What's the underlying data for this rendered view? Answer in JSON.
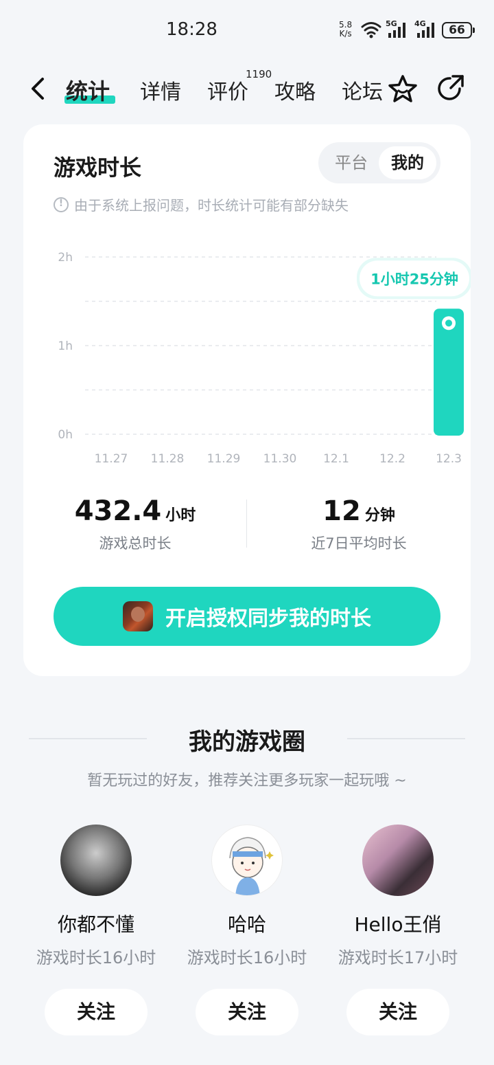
{
  "status_bar": {
    "time": "18:28",
    "net_speed_value": "5.8",
    "net_speed_unit": "K/s",
    "signal1": "5G",
    "signal2": "4G",
    "battery": "66"
  },
  "nav": {
    "tabs": [
      {
        "label": "统计",
        "active": true
      },
      {
        "label": "详情"
      },
      {
        "label": "评价",
        "badge": "1190"
      },
      {
        "label": "攻略"
      },
      {
        "label": "论坛"
      }
    ],
    "back_icon": "chevron-left-icon",
    "favorite_icon": "star-icon",
    "share_icon": "share-icon"
  },
  "card": {
    "title": "游戏时长",
    "toggle": {
      "options": [
        "平台",
        "我的"
      ],
      "selected": "我的"
    },
    "notice": "由于系统上报问题，时长统计可能有部分缺失",
    "stats": [
      {
        "value": "432.4",
        "unit": "小时",
        "label": "游戏总时长"
      },
      {
        "value": "12",
        "unit": "分钟",
        "label": "近7日平均时长"
      }
    ],
    "sync_button": "开启授权同步我的时长"
  },
  "chart_data": {
    "type": "bar",
    "categories": [
      "11.27",
      "11.28",
      "11.29",
      "11.30",
      "12.1",
      "12.2",
      "12.3"
    ],
    "values_minutes": [
      0,
      0,
      0,
      0,
      0,
      0,
      85
    ],
    "y_ticks": [
      "0h",
      "1h",
      "2h"
    ],
    "ylim_minutes": [
      0,
      120
    ],
    "grid": true,
    "highlight": {
      "category": "12.3",
      "label": "1小时25分钟"
    },
    "bar_color": "#1fd6bf"
  },
  "circle": {
    "title": "我的游戏圈",
    "subtitle": "暂无玩过的好友，推荐关注更多玩家一起玩哦 ~",
    "friends": [
      {
        "name": "你都不懂",
        "meta": "游戏时长16小时",
        "follow": "关注"
      },
      {
        "name": "哈哈",
        "meta": "游戏时长16小时",
        "follow": "关注"
      },
      {
        "name": "Hello王俏",
        "meta": "游戏时长17小时",
        "follow": "关注"
      }
    ]
  }
}
